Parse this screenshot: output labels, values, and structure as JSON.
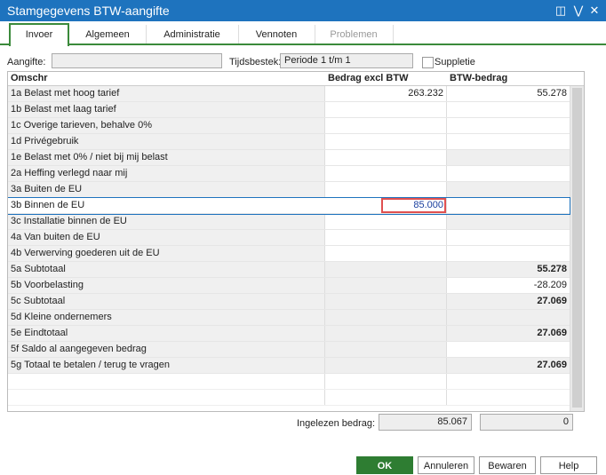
{
  "window": {
    "title": "Stamgegevens BTW-aangifte"
  },
  "tabs": [
    {
      "label": "Invoer"
    },
    {
      "label": "Algemeen"
    },
    {
      "label": "Administratie"
    },
    {
      "label": "Vennoten"
    },
    {
      "label": "Problemen"
    }
  ],
  "form": {
    "aangifte_label": "Aangifte:",
    "aangifte_value": "",
    "tijdsbestek_label": "Tijdsbestek:",
    "tijdsbestek_value": "Periode 1 t/m 1",
    "suppletie_label": "Suppletie",
    "suppletie_checked": false
  },
  "grid": {
    "headers": [
      "Omschr",
      "Bedrag excl BTW",
      "BTW-bedrag"
    ],
    "rows": [
      {
        "omschr": "1a Belast met hoog tarief",
        "bedrag": "263.232",
        "btw": "55.278"
      },
      {
        "omschr": "1b Belast met laag tarief",
        "bedrag": "",
        "btw": ""
      },
      {
        "omschr": "1c Overige tarieven, behalve 0%",
        "bedrag": "",
        "btw": ""
      },
      {
        "omschr": "1d Privégebruik",
        "bedrag": "",
        "btw": ""
      },
      {
        "omschr": "1e Belast met 0% / niet bij mij belast",
        "bedrag": "",
        "btw": ""
      },
      {
        "omschr": "2a Heffing verlegd naar mij",
        "bedrag": "",
        "btw": ""
      },
      {
        "omschr": "3a Buiten de EU",
        "bedrag": "",
        "btw": ""
      },
      {
        "omschr": "3b Binnen de EU",
        "bedrag": "85.000",
        "btw": ""
      },
      {
        "omschr": "3c Installatie binnen de EU",
        "bedrag": "",
        "btw": ""
      },
      {
        "omschr": "4a Van buiten de EU",
        "bedrag": "",
        "btw": ""
      },
      {
        "omschr": "4b Verwerving goederen uit de EU",
        "bedrag": "",
        "btw": ""
      },
      {
        "omschr": "5a Subtotaal",
        "bedrag": "",
        "btw": "55.278"
      },
      {
        "omschr": "5b Voorbelasting",
        "bedrag": "",
        "btw": "-28.209"
      },
      {
        "omschr": "5c Subtotaal",
        "bedrag": "",
        "btw": "27.069"
      },
      {
        "omschr": "5d Kleine ondernemers",
        "bedrag": "",
        "btw": ""
      },
      {
        "omschr": "5e Eindtotaal",
        "bedrag": "",
        "btw": "27.069"
      },
      {
        "omschr": "5f Saldo al aangegeven bedrag",
        "bedrag": "",
        "btw": ""
      },
      {
        "omschr": "5g Totaal te betalen / terug te vragen",
        "bedrag": "",
        "btw": "27.069"
      }
    ]
  },
  "footer": {
    "ingelezen_label": "Ingelezen bedrag:",
    "ingelezen_value": "85.067",
    "ingelezen_value2": "0"
  },
  "buttons": {
    "ok": "OK",
    "annuleren": "Annuleren",
    "bewaren": "Bewaren",
    "help": "Help"
  }
}
